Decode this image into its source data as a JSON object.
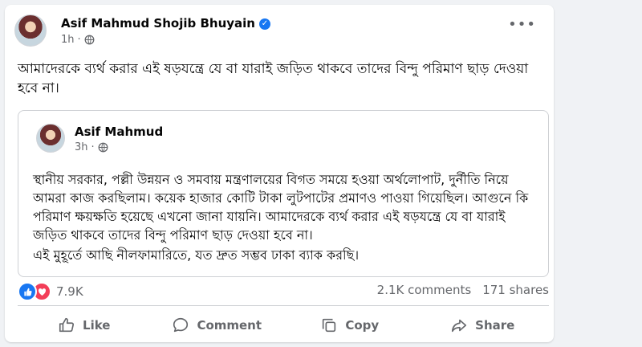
{
  "post": {
    "author": "Asif Mahmud Shojib Bhuyain",
    "verified": true,
    "time": "1h",
    "privacy_icon": "globe-icon",
    "text": "আমাদেরকে ব্যর্থ করার এই ষড়যন্ত্রে যে বা যারাই জড়িত থাকবে তাদের বিন্দু পরিমাণ ছাড় দেওয়া হবে না।"
  },
  "shared_post": {
    "author": "Asif Mahmud",
    "time": "3h",
    "privacy_icon": "globe-icon",
    "paragraph_1": "স্থানীয় সরকার, পল্লী উন্নয়ন ও সমবায় মন্ত্রণালয়ের বিগত সময়ে হওয়া অর্থলোপাট, দুর্নীতি নিয়ে আমরা কাজ করছিলাম। কয়েক হাজার কোটি টাকা লুটপাটের প্রমাণও পাওয়া গিয়েছিল। আগুনে কি পরিমাণ ক্ষয়ক্ষতি হয়েছে এখনো জানা যায়নি। আমাদেরকে ব্যর্থ করার এই ষড়যন্ত্রে যে বা যারাই জড়িত থাকবে তাদের বিন্দু পরিমাণ ছাড় দেওয়া হবে না।",
    "paragraph_2": "এই মুহূর্তে আছি নীলফামারিতে, যত দ্রুত সম্ভব ঢাকা ব্যাক করছি।"
  },
  "stats": {
    "reaction_icons": [
      "like-icon",
      "love-icon"
    ],
    "reactions": "7.9K",
    "comments": "2.1K comments",
    "shares": "171 shares"
  },
  "actions": {
    "like": "Like",
    "comment": "Comment",
    "copy": "Copy",
    "share": "Share"
  },
  "colors": {
    "accent": "#1877f2",
    "love": "#f33e58",
    "muted_text": "#65676b",
    "background": "#f0f2f5"
  }
}
